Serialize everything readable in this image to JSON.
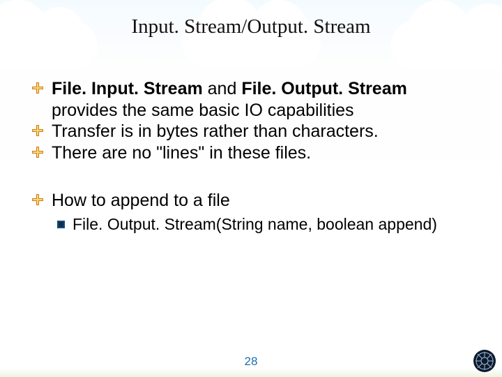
{
  "title": "Input. Stream/Output. Stream",
  "bullets": [
    {
      "pre_bold1": "File. Input. Stream",
      "mid": " and ",
      "pre_bold2": "File. Output. Stream",
      "rest": " provides the same basic IO capabilities"
    },
    {
      "text": "Transfer is in bytes rather than characters."
    },
    {
      "text": "There are no \"lines\" in these files."
    },
    {
      "text": "How to append to a file"
    }
  ],
  "sub_bullet": "File. Output. Stream(String name, boolean append)",
  "page_number": "28"
}
